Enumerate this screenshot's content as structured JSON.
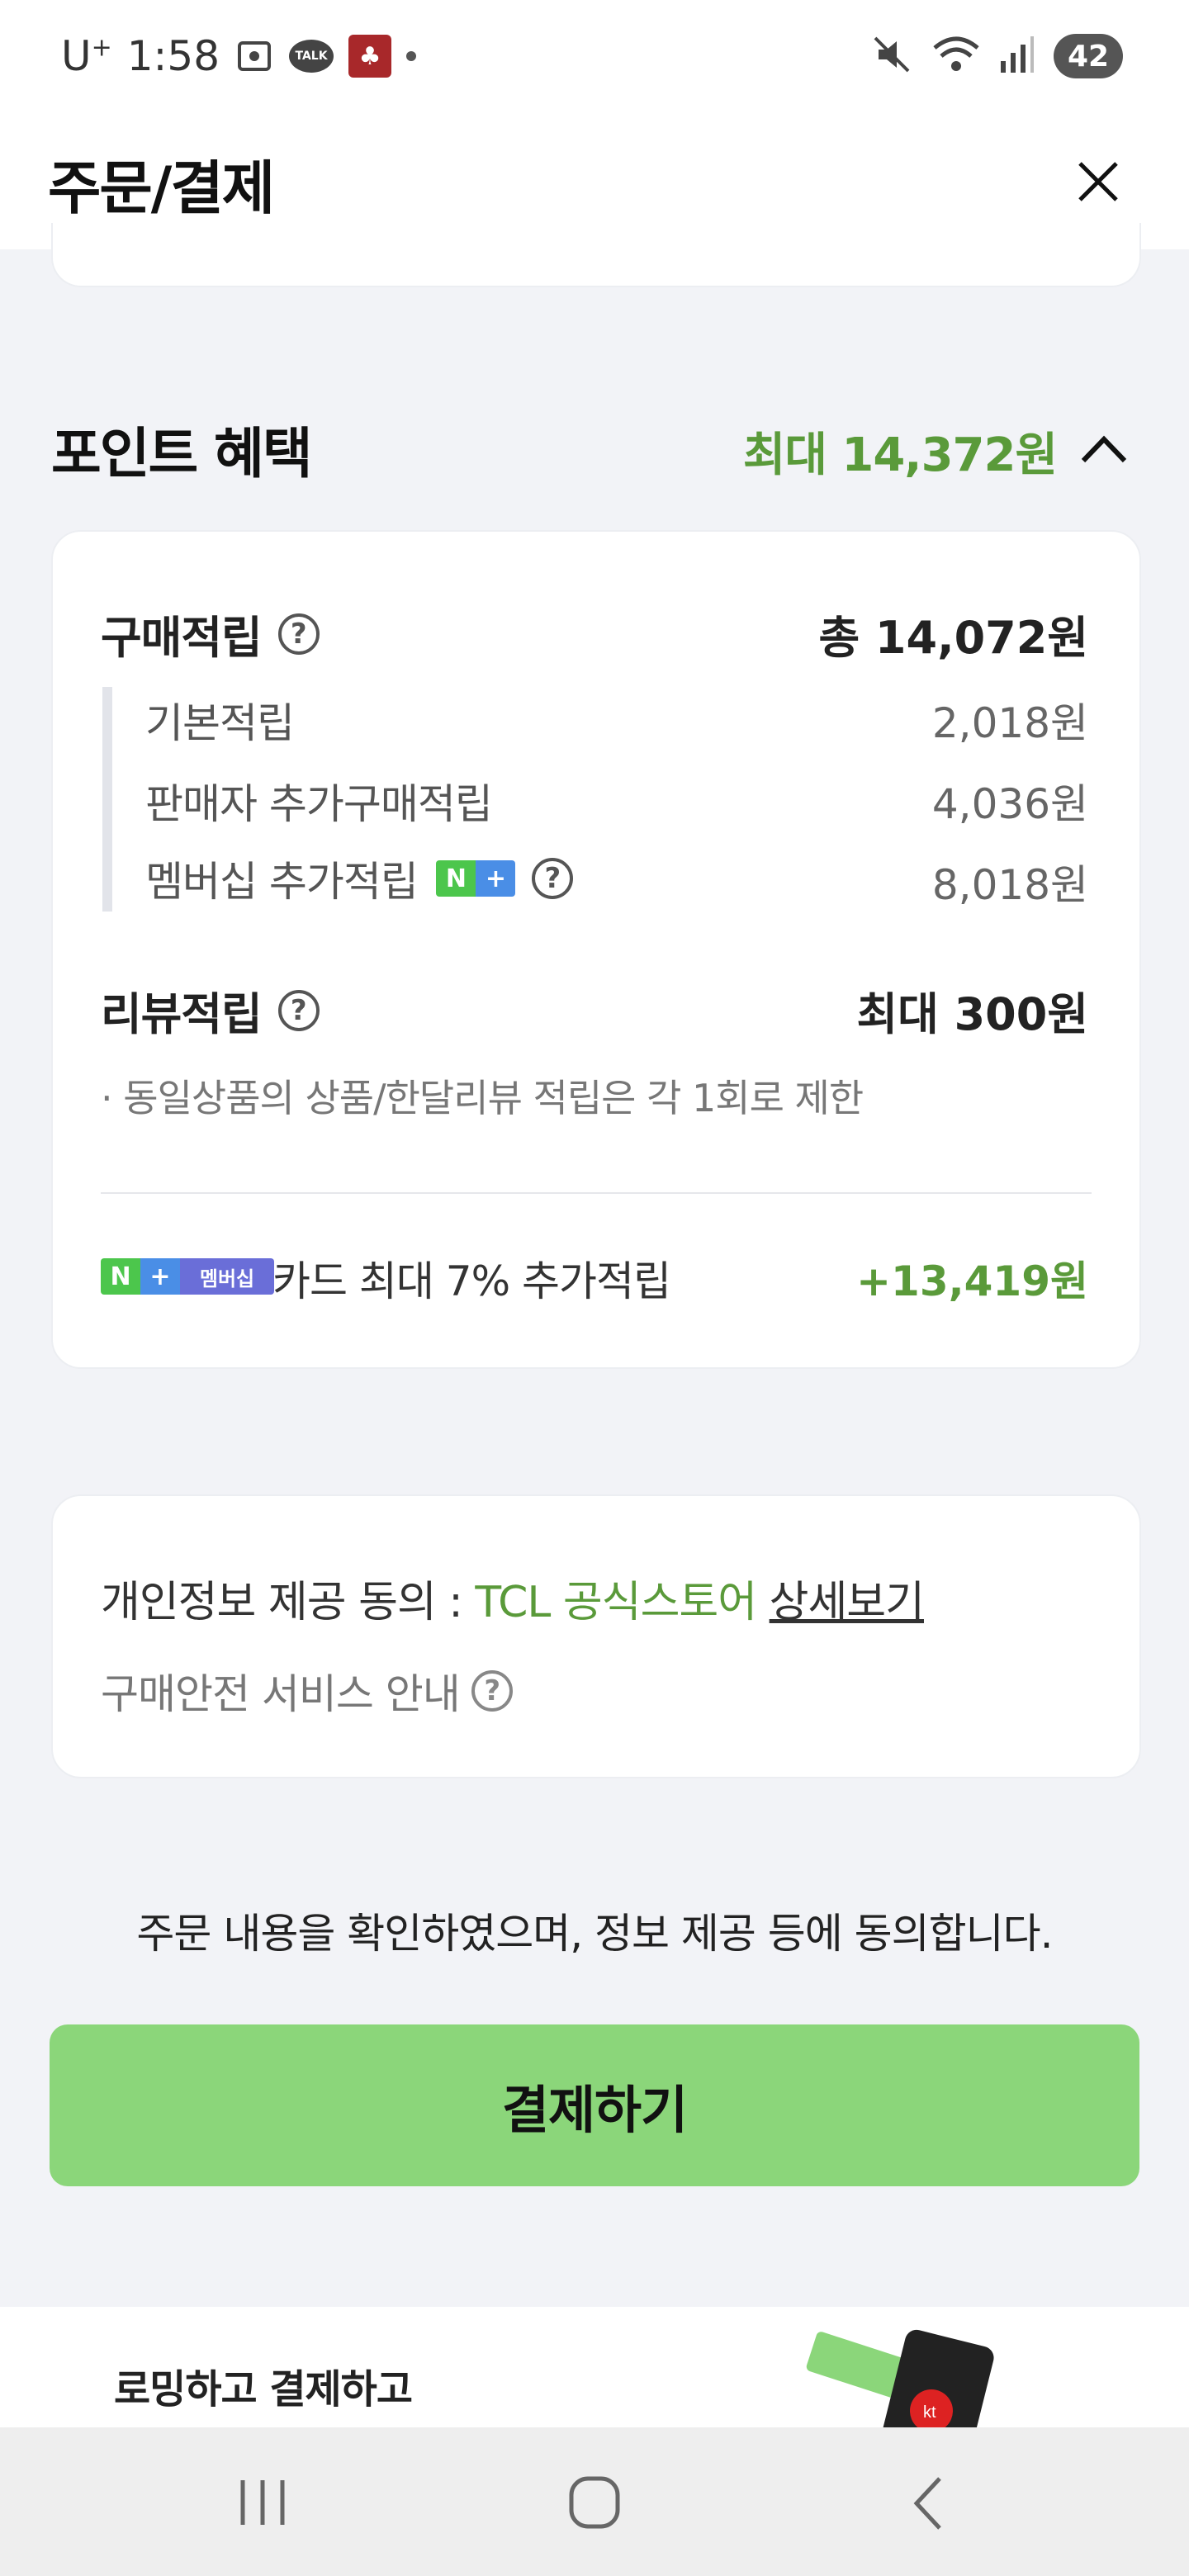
{
  "status": {
    "carrier": "U",
    "carrier_sup": "+",
    "time": "1:58",
    "talk_badge": "TALK",
    "battery": "42"
  },
  "header": {
    "title": "주문/결제"
  },
  "points": {
    "section_title": "포인트 혜택",
    "section_max": "최대 14,372원",
    "purchase": {
      "label": "구매적립",
      "total": "총 14,072원",
      "items": [
        {
          "label": "기본적립",
          "value": "2,018원"
        },
        {
          "label": "판매자 추가구매적립",
          "value": "4,036원"
        },
        {
          "label": "멤버십 추가적립",
          "value": "8,018원"
        }
      ]
    },
    "review": {
      "label": "리뷰적립",
      "value": "최대 300원",
      "note": "· 동일상품의 상품/한달리뷰 적립은 각 1회로 제한"
    },
    "card": {
      "badge_n": "N",
      "badge_plus": "+",
      "badge_member": "멤버십",
      "text": "카드 최대 7% 추가적립",
      "value": "+13,419원"
    }
  },
  "privacy": {
    "prefix": "개인정보 제공 동의 : ",
    "store": "TCL 공식스토어",
    "link": "상세보기",
    "safe": "구매안전 서비스 안내"
  },
  "agree_text": "주문 내용을 확인하였으며, 정보 제공 등에 동의합니다.",
  "pay_button": "결제하기",
  "banner": {
    "text": "로밍하고 결제하고"
  },
  "colors": {
    "accent_green": "#5a9a3a",
    "pay_button": "#8bd67a",
    "background": "#f2f3f7"
  }
}
